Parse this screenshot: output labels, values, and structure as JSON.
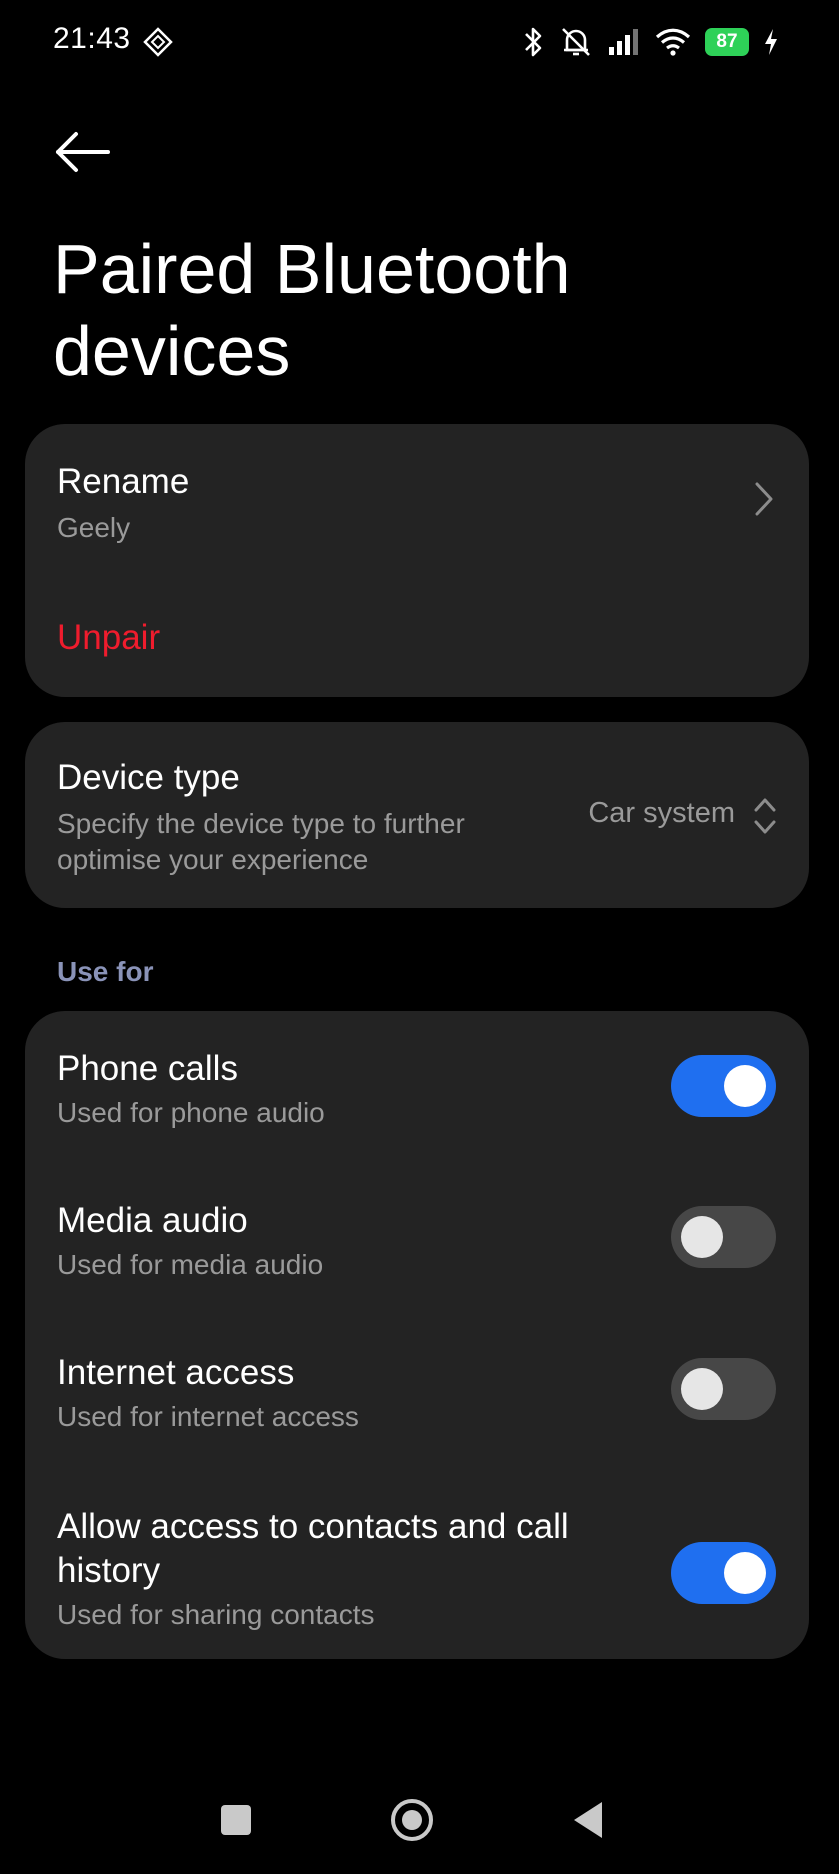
{
  "status_bar": {
    "time": "21:43",
    "battery": "87",
    "icons": [
      "diamond-icon",
      "bluetooth-icon",
      "bell-off-icon",
      "signal-icon",
      "wifi-icon",
      "battery-icon",
      "charging-icon"
    ],
    "battery_color": "#2ed158"
  },
  "header": {
    "back_icon": "arrow-left-icon",
    "title": "Paired Bluetooth devices"
  },
  "rename_card": {
    "title": "Rename",
    "value": "Geely",
    "unpair_label": "Unpair",
    "unpair_color": "#ef1c2d"
  },
  "device_type": {
    "title": "Device type",
    "subtitle": "Specify the device type to further optimise your experience",
    "value": "Car system"
  },
  "use_for": {
    "header": "Use for",
    "items": [
      {
        "title": "Phone calls",
        "subtitle": "Used for phone audio",
        "enabled": true
      },
      {
        "title": "Media audio",
        "subtitle": "Used for media audio",
        "enabled": false
      },
      {
        "title": "Internet access",
        "subtitle": "Used for internet access",
        "enabled": false
      },
      {
        "title": "Allow access to contacts and call history",
        "subtitle": "Used for sharing contacts",
        "enabled": true
      }
    ]
  },
  "nav_bar": {
    "buttons": [
      "recents-icon",
      "home-icon",
      "back-icon"
    ]
  },
  "colors": {
    "background": "#000000",
    "card": "#232323",
    "accent": "#1f6ff0",
    "section_header": "#8a93b8"
  }
}
